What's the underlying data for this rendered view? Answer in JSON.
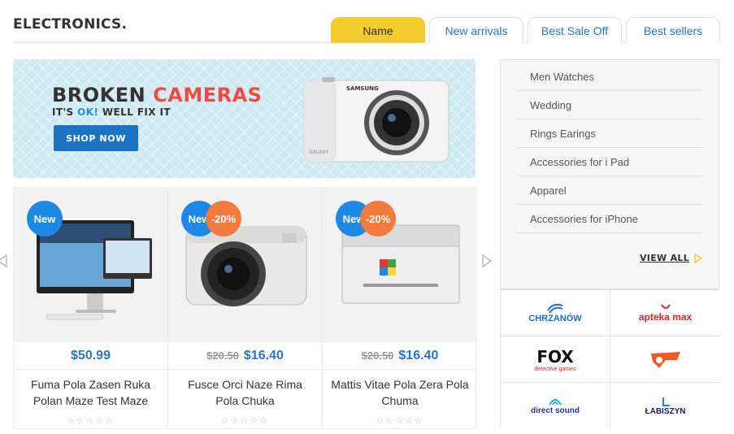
{
  "section": {
    "title": "ELECTRONICS."
  },
  "tabs": [
    {
      "label": "Name",
      "active": true
    },
    {
      "label": "New arrivals",
      "active": false
    },
    {
      "label": "Best Sale Off",
      "active": false
    },
    {
      "label": "Best sellers",
      "active": false
    }
  ],
  "banner": {
    "headline_dark": "BROKEN",
    "headline_red": "CAMERAS",
    "sub_prefix": "IT'S",
    "sub_ok": "OK!",
    "sub_suffix": "WELL FIX IT",
    "button_label": "SHOP NOW",
    "camera_brand": "SAMSUNG",
    "camera_model": "GALAXY"
  },
  "products": [
    {
      "badge_new": "New",
      "badge_sale": "",
      "old_price": "",
      "price": "$50.99",
      "name": "Fuma Pola Zasen Ruka Polan Maze Test Maze",
      "stars": "☆☆☆☆☆"
    },
    {
      "badge_new": "New",
      "badge_sale": "-20%",
      "old_price": "$20.50",
      "price": "$16.40",
      "name": "Fusce Orci Naze Rima Pola Chuka",
      "stars": "☆☆☆☆☆"
    },
    {
      "badge_new": "New",
      "badge_sale": "-20%",
      "old_price": "$20.50",
      "price": "$16.40",
      "name": "Mattis Vitae Pola Zera Pola Chuma",
      "stars": "☆☆☆☆☆"
    }
  ],
  "categories": [
    "Men Watches",
    "Wedding",
    "Rings Earings",
    "Accessories for i Pad",
    "Apparel",
    "Accessories for iPhone"
  ],
  "view_all": "VIEW ALL",
  "brands": [
    {
      "name": "CHRZANÓW",
      "color": "#1f6fc4"
    },
    {
      "name": "apteka max",
      "color": "#d9262a"
    },
    {
      "name": "FOX",
      "sub": "detective games",
      "color": "#111111"
    },
    {
      "name": "",
      "color": "#f05a24"
    },
    {
      "name": "direct sound",
      "color": "#1f3a93"
    },
    {
      "name": "ŁABISZYN",
      "color": "#1a1a5a"
    }
  ],
  "colors": {
    "accent_blue": "#2a74c9",
    "active_tab": "#f3cc2f",
    "badge_new": "#1e88e5",
    "badge_sale": "#f27c40",
    "banner_bg": "#cfeaf3"
  }
}
